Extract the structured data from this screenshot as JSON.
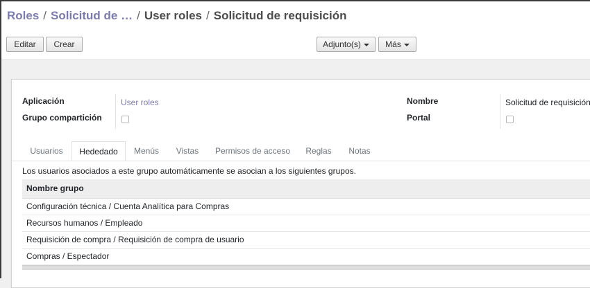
{
  "breadcrumb": {
    "crumb1": "Roles",
    "crumb2": "Solicitud de …",
    "crumb3": "User roles",
    "current": "Solicitud de requisición",
    "separator": "/"
  },
  "toolbar": {
    "edit_label": "Editar",
    "create_label": "Crear",
    "attachments_label": "Adjunto(s)",
    "more_label": "Más"
  },
  "form": {
    "aplicacion_label": "Aplicación",
    "aplicacion_value": "User roles",
    "grupo_label": "Grupo compartición",
    "grupo_checked": false,
    "nombre_label": "Nombre",
    "nombre_value": "Solicitud de requisición",
    "portal_label": "Portal",
    "portal_checked": false
  },
  "tabs": [
    {
      "label": "Usuarios",
      "active": false
    },
    {
      "label": "Hededado",
      "active": true
    },
    {
      "label": "Menús",
      "active": false
    },
    {
      "label": "Vistas",
      "active": false
    },
    {
      "label": "Permisos de acceso",
      "active": false
    },
    {
      "label": "Reglas",
      "active": false
    },
    {
      "label": "Notas",
      "active": false
    }
  ],
  "inherited": {
    "description": "Los usuarios asociados a este grupo automáticamente se asocian a los siguientes grupos.",
    "column_header": "Nombre grupo",
    "rows": [
      "Configuración técnica / Cuenta Analítica para Compras",
      "Recursos humanos / Empleado",
      "Requisición de compra / Requisición de compra de usuario",
      "Compras / Espectador"
    ]
  },
  "colors": {
    "link": "#7c7bad",
    "text": "#212529",
    "background": "#f0f0f0"
  }
}
